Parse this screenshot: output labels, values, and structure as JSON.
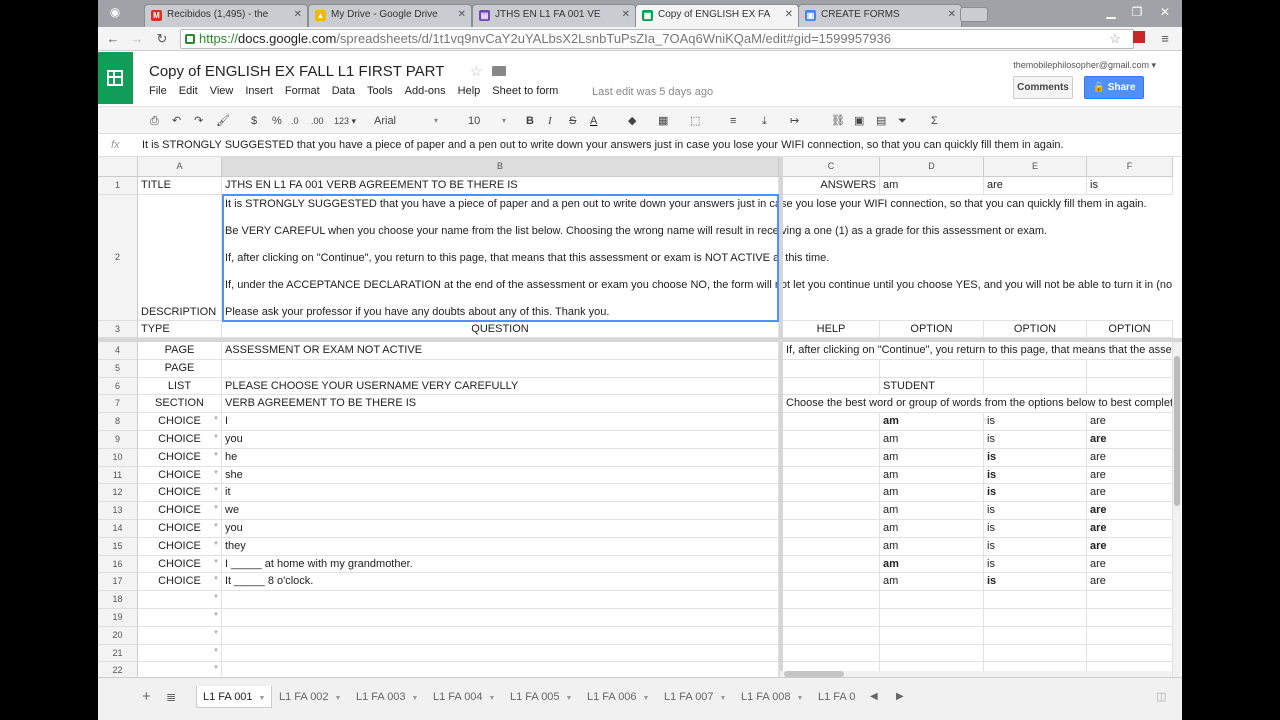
{
  "browser": {
    "tabs": [
      {
        "label": "Recibidos (1,495) - the",
        "favicon": "M",
        "color": "#d93025"
      },
      {
        "label": "My Drive - Google Drive",
        "favicon": "▲",
        "color": "#f2b705"
      },
      {
        "label": "JTHS EN L1 FA 001 VE",
        "favicon": "▤",
        "color": "#7248b9"
      },
      {
        "label": "Copy of ENGLISH EX FA",
        "favicon": "▦",
        "color": "#0f9d58"
      },
      {
        "label": "CREATE FORMS",
        "favicon": "▣",
        "color": "#4285f4"
      }
    ],
    "url_scheme": "https://",
    "url_host": "docs.google.com",
    "url_path": "/spreadsheets/d/1t1vq9nvCaY2uYALbsX2LsnbTuPsZIa_7OAq6WniKQaM/edit#gid=1599957936"
  },
  "doc": {
    "title": "Copy of ENGLISH EX FALL L1 FIRST PART",
    "menus": [
      "File",
      "Edit",
      "View",
      "Insert",
      "Format",
      "Data",
      "Tools",
      "Add-ons",
      "Help",
      "Sheet to form"
    ],
    "last_edit": "Last edit was 5 days ago",
    "user_email": "themobilephilosopher@gmail.com ▾",
    "comments_label": "Comments",
    "share_label": "Share"
  },
  "toolbar": {
    "font": "Arial",
    "font_size": "10",
    "number_format": "123 ▾",
    "currency": "$",
    "percent": "%",
    "dec_less": ".0",
    "dec_more": ".00"
  },
  "formula_bar": {
    "fx": "fx",
    "content": "It is STRONGLY SUGGESTED that you have a piece of paper and a pen out to write down your answers just in case you lose your WIFI connection, so that you can quickly fill them in again."
  },
  "grid": {
    "columns": [
      "A",
      "B",
      "C",
      "D",
      "E",
      "F"
    ],
    "row1": {
      "num": "1",
      "a": "TITLE",
      "b": "JTHS EN L1 FA 001 VERB AGREEMENT TO BE THERE IS",
      "c": "ANSWERS",
      "d": "am",
      "e": "are",
      "f": "is"
    },
    "row2": {
      "num": "2",
      "a": "DESCRIPTION",
      "lines": [
        "It is STRONGLY SUGGESTED that you have a piece of paper and a pen out to write down your answers just in case you lose your WIFI connection, so that you can quickly fill them in again.",
        "Be VERY CAREFUL when you choose your name from the list below. Choosing the wrong name will result in receiving a one (1) as a grade for this assessment or exam.",
        "If, after clicking on \"Continue\", you return to this page, that means that this assessment or exam is NOT ACTIVE at this time.",
        "If, under the ACCEPTANCE DECLARATION at the end of the assessment or exam you choose NO, the form will not let you continue until you choose YES, and you will not be able to turn it in (no",
        "Please ask your professor if you have any doubts about any of this. Thank you."
      ]
    },
    "row3": {
      "num": "3",
      "a": "TYPE",
      "b": "QUESTION",
      "c": "HELP",
      "d": "OPTION",
      "e": "OPTION",
      "f": "OPTION"
    },
    "rows": [
      {
        "num": "4",
        "a": "PAGE",
        "b": "ASSESSMENT OR EXAM NOT ACTIVE",
        "c": "If, after clicking on \"Continue\", you return to this page, that means that the asse",
        "d": "",
        "e": "",
        "f": ""
      },
      {
        "num": "5",
        "a": "PAGE",
        "b": "",
        "c": "",
        "d": "",
        "e": "",
        "f": ""
      },
      {
        "num": "6",
        "a": "LIST",
        "b": "PLEASE CHOOSE YOUR USERNAME VERY CAREFULLY",
        "c": "",
        "d": "STUDENT",
        "e": "",
        "f": ""
      },
      {
        "num": "7",
        "a": "SECTION",
        "b": "VERB AGREEMENT TO BE THERE IS",
        "c": "Choose the best word or group of words from the options below to best complet",
        "d": "",
        "e": "",
        "f": ""
      },
      {
        "num": "8",
        "a": "CHOICE",
        "b": "I",
        "c": "",
        "d": "am",
        "e": "is",
        "f": "are"
      },
      {
        "num": "9",
        "a": "CHOICE",
        "b": "you",
        "c": "",
        "d": "am",
        "e": "is",
        "f": "are"
      },
      {
        "num": "10",
        "a": "CHOICE",
        "b": "he",
        "c": "",
        "d": "am",
        "e": "is",
        "f": "are"
      },
      {
        "num": "11",
        "a": "CHOICE",
        "b": "she",
        "c": "",
        "d": "am",
        "e": "is",
        "f": "are"
      },
      {
        "num": "12",
        "a": "CHOICE",
        "b": "it",
        "c": "",
        "d": "am",
        "e": "is",
        "f": "are"
      },
      {
        "num": "13",
        "a": "CHOICE",
        "b": "we",
        "c": "",
        "d": "am",
        "e": "is",
        "f": "are"
      },
      {
        "num": "14",
        "a": "CHOICE",
        "b": "you",
        "c": "",
        "d": "am",
        "e": "is",
        "f": "are"
      },
      {
        "num": "15",
        "a": "CHOICE",
        "b": "they",
        "c": "",
        "d": "am",
        "e": "is",
        "f": "are"
      },
      {
        "num": "16",
        "a": "CHOICE",
        "b": "I _____ at home with my grandmother.",
        "c": "",
        "d": "am",
        "e": "is",
        "f": "are"
      },
      {
        "num": "17",
        "a": "CHOICE",
        "b": "It _____ 8 o'clock.",
        "c": "",
        "d": "am",
        "e": "is",
        "f": "are"
      },
      {
        "num": "18",
        "a": "",
        "b": "",
        "c": "",
        "d": "",
        "e": "",
        "f": ""
      },
      {
        "num": "19",
        "a": "",
        "b": "",
        "c": "",
        "d": "",
        "e": "",
        "f": ""
      },
      {
        "num": "20",
        "a": "",
        "b": "",
        "c": "",
        "d": "",
        "e": "",
        "f": ""
      },
      {
        "num": "21",
        "a": "",
        "b": "",
        "c": "",
        "d": "",
        "e": "",
        "f": ""
      },
      {
        "num": "22",
        "a": "",
        "b": "",
        "c": "",
        "d": "",
        "e": "",
        "f": ""
      }
    ],
    "bold_answers": {
      "8": "d",
      "9": "f",
      "10": "e",
      "11": "e",
      "12": "e",
      "13": "f",
      "14": "f",
      "15": "f",
      "16": "d",
      "17": "e"
    }
  },
  "sheet_tabs": [
    "L1 FA 001",
    "L1 FA 002",
    "L1 FA 003",
    "L1 FA 004",
    "L1 FA 005",
    "L1 FA 006",
    "L1 FA 007",
    "L1 FA 008",
    "L1 FA 0"
  ]
}
